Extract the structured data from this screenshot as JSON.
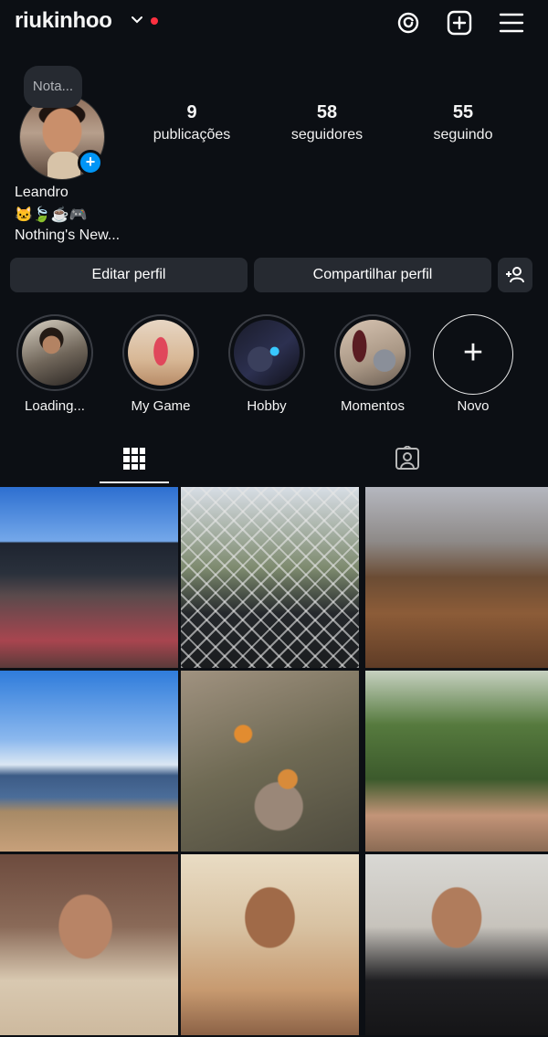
{
  "header": {
    "username": "riukinhoo",
    "icons": [
      "chevron-down-icon",
      "threads-icon",
      "new-post-icon",
      "menu-icon"
    ],
    "notification_dot_color": "#ff3040"
  },
  "profile": {
    "note_placeholder": "Nota...",
    "name": "Leandro",
    "bio_emojis": "🐱🍃☕🎮",
    "bio_text": "Nothing's New...",
    "stats": [
      {
        "value": "9",
        "label": "publicações"
      },
      {
        "value": "58",
        "label": "seguidores"
      },
      {
        "value": "55",
        "label": "seguindo"
      }
    ]
  },
  "actions": {
    "edit_profile": "Editar perfil",
    "share_profile": "Compartilhar perfil",
    "discover_icon": "add-person-icon"
  },
  "highlights": [
    {
      "label": "Loading..."
    },
    {
      "label": "My Game"
    },
    {
      "label": "Hobby"
    },
    {
      "label": "Momentos"
    },
    {
      "label": "Novo"
    }
  ],
  "tabs": [
    "grid-icon",
    "tagged-icon"
  ],
  "posts": [
    "road-photo",
    "cat-fence-photo",
    "blurred-field-photo",
    "lake-beach-photo",
    "koi-pond-photo",
    "forest-bridge-photo",
    "selfie-shoe-store-photo",
    "selfie-mirror-photo",
    "selfie-bathroom-photo"
  ],
  "colors": {
    "background": "#0c0f14",
    "button_bg": "#262a31",
    "accent_blue": "#0095f6"
  }
}
